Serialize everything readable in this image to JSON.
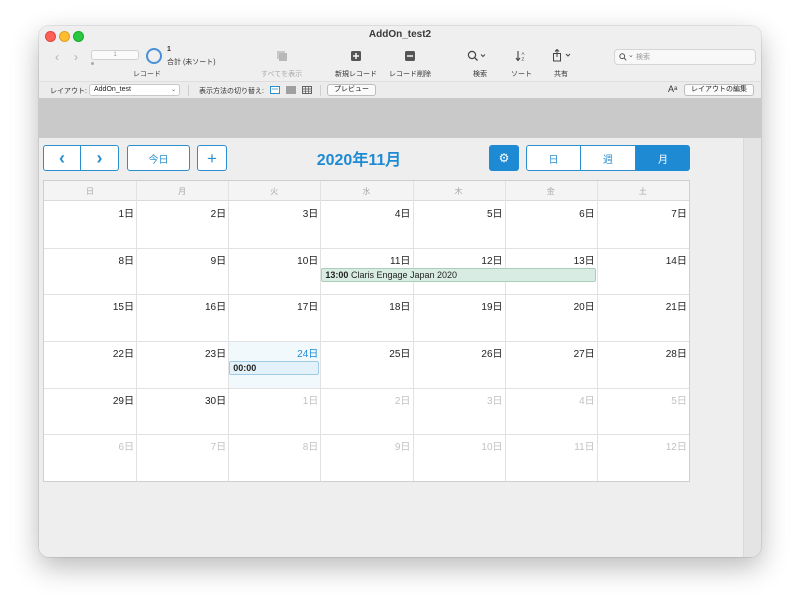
{
  "window": {
    "title": "AddOn_test2"
  },
  "toolbar": {
    "record_slider_value": "1",
    "record_count": "1",
    "record_total": "合計 (未ソート)",
    "record_caption": "レコード",
    "show_all": "すべてを表示",
    "new_record": "新規レコード",
    "delete_record": "レコード削除",
    "find": "検索",
    "sort": "ソート",
    "share": "共有",
    "search_placeholder": "検索"
  },
  "layoutbar": {
    "layout_label": "レイアウト:",
    "layout_value": "AddOn_test",
    "view_as_label": "表示方法の切り替え:",
    "preview_button": "プレビュー",
    "edit_layout_button": "レイアウトの編集",
    "font_icon_text": "Aᵃ"
  },
  "calendar": {
    "title": "2020年11月",
    "prev_symbol": "‹",
    "next_symbol": "›",
    "today_label": "今日",
    "add_symbol": "+",
    "settings_symbol": "⚙",
    "views": [
      {
        "label": "日",
        "active": false
      },
      {
        "label": "週",
        "active": false
      },
      {
        "label": "月",
        "active": true
      }
    ],
    "weekdays": [
      "日",
      "月",
      "火",
      "水",
      "木",
      "金",
      "土"
    ],
    "weeks": [
      [
        "1日",
        "2日",
        "3日",
        "4日",
        "5日",
        "6日",
        "7日"
      ],
      [
        "8日",
        "9日",
        "10日",
        "11日",
        "12日",
        "13日",
        "14日"
      ],
      [
        "15日",
        "16日",
        "17日",
        "18日",
        "19日",
        "20日",
        "21日"
      ],
      [
        "22日",
        "23日",
        "24日",
        "25日",
        "26日",
        "27日",
        "28日"
      ],
      [
        "29日",
        "30日",
        "1日",
        "2日",
        "3日",
        "4日",
        "5日"
      ],
      [
        "6日",
        "7日",
        "8日",
        "9日",
        "10日",
        "11日",
        "12日"
      ]
    ],
    "today_day": "24日",
    "events": [
      {
        "time": "13:00",
        "title": "Claris Engage Japan 2020",
        "color": "#d9ece3"
      },
      {
        "time": "00:00",
        "title": "",
        "color": "#e3f2fa"
      }
    ]
  },
  "colors": {
    "accent": "#1e8ad3",
    "event_green": "#d9ece3",
    "event_blue": "#e3f2fa"
  }
}
